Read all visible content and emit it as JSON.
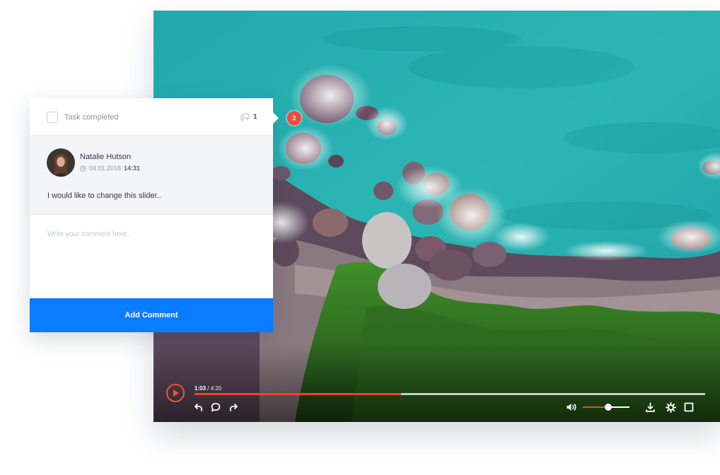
{
  "comment_card": {
    "task_label": "Task completed",
    "comment_count": "1",
    "author": "Natalie Hutson",
    "date": "04.01.2016",
    "time": "14:31",
    "comment": "I would like to change this slider..",
    "input_placeholder": "Write your comment here..",
    "submit_label": "Add Comment"
  },
  "annotation_badge": "2",
  "player": {
    "current_time": "1:03",
    "separator": " / ",
    "total_time": "4:20",
    "progress_percent": 40.5,
    "volume_percent": 55,
    "accent_color": "#e8452f"
  },
  "colors": {
    "primary_button": "#0a7cff",
    "badge": "#ef4a3a"
  },
  "icons": {
    "play": "play-icon",
    "undo": "undo-icon",
    "comment": "comment-icon",
    "redo": "redo-icon",
    "volume": "volume-icon",
    "download": "download-icon",
    "settings": "gear-icon",
    "fullscreen": "fullscreen-icon",
    "comments_count": "comments-icon",
    "clock": "clock-icon"
  }
}
